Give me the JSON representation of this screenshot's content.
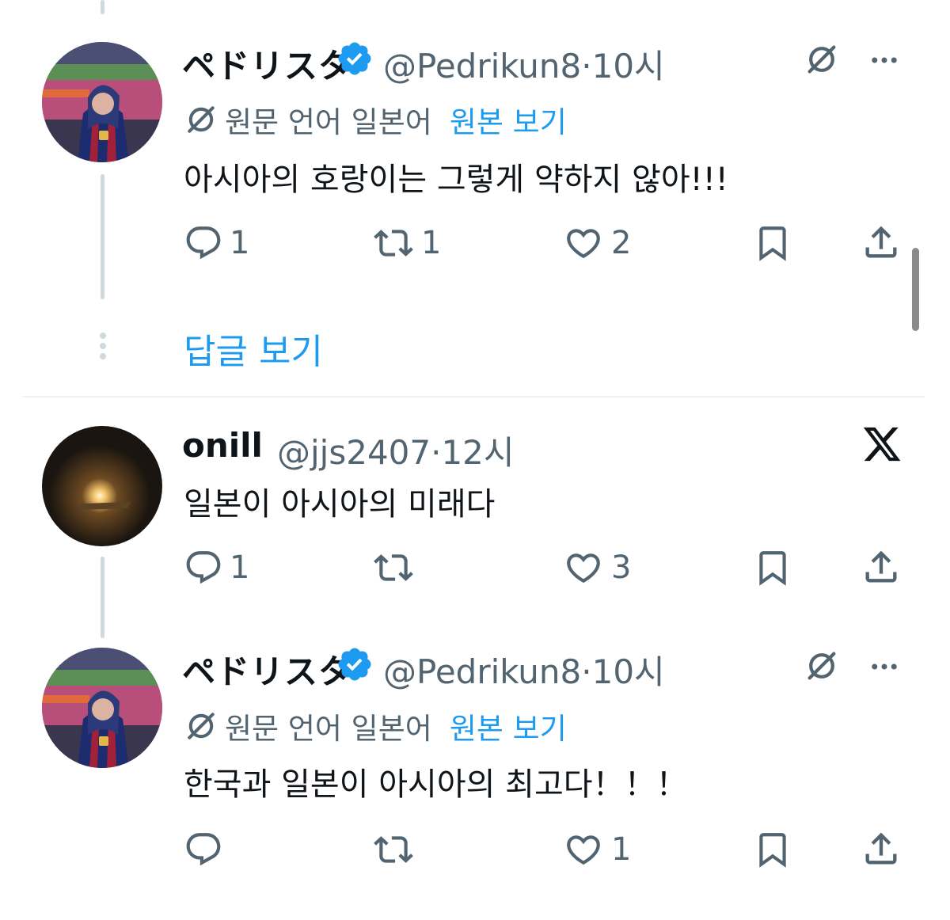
{
  "colors": {
    "accent": "#1d9bf0",
    "secondary_text": "#536471",
    "primary_text": "#0f1419",
    "thread_line": "#cfd9de"
  },
  "tweets": [
    {
      "display_name": "ペドリスタ",
      "verified": true,
      "handle_time": "@Pedrikun8·10시",
      "translation_label": "원문 언어 일본어",
      "translation_link": "원본 보기",
      "text": "아시아의 호랑이는 그렇게 약하지 않아!!!",
      "reply_count": "1",
      "retweet_count": "1",
      "like_count": "2",
      "icons": [
        "translate-icon",
        "more-icon",
        "reply-icon",
        "retweet-icon",
        "like-icon",
        "bookmark-icon",
        "share-icon"
      ]
    },
    {
      "display_name": "onill",
      "verified": false,
      "handle_time": "@jjs2407·12시",
      "text": "일본이 아시아의 미래다",
      "reply_count": "1",
      "retweet_count": "",
      "like_count": "3",
      "icons": [
        "x-logo-icon",
        "reply-icon",
        "retweet-icon",
        "like-icon",
        "bookmark-icon",
        "share-icon"
      ]
    },
    {
      "display_name": "ペドリスタ",
      "verified": true,
      "handle_time": "@Pedrikun8·10시",
      "translation_label": "원문 언어 일본어",
      "translation_link": "원본 보기",
      "text": "한국과 일본이 아시아의 최고다！！！",
      "reply_count": "",
      "retweet_count": "",
      "like_count": "1",
      "icons": [
        "translate-icon",
        "more-icon",
        "reply-icon",
        "retweet-icon",
        "like-icon",
        "bookmark-icon",
        "share-icon"
      ]
    }
  ],
  "show_replies_label": "답글 보기"
}
